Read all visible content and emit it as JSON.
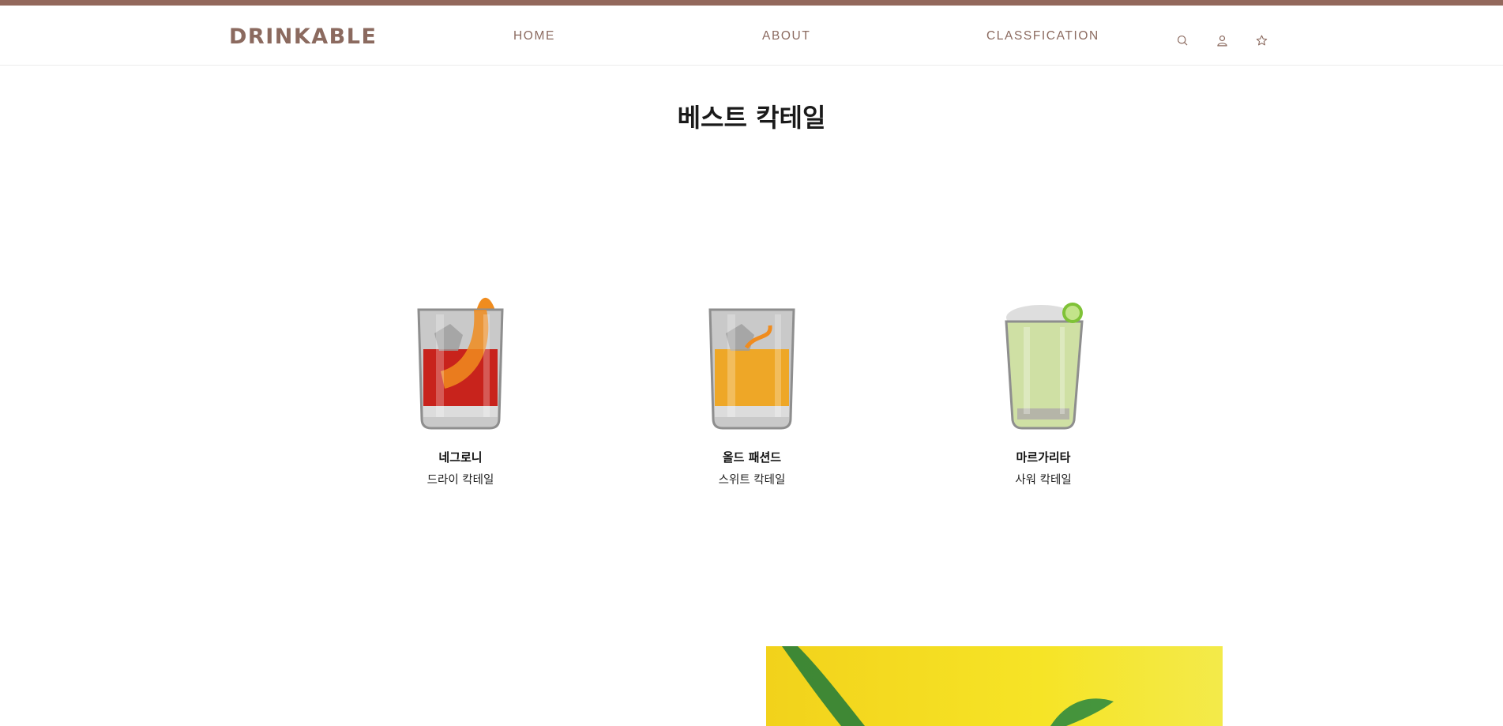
{
  "header": {
    "logo": "DRINKABLE",
    "nav": {
      "home": "HOME",
      "about": "ABOUT",
      "classification": "CLASSFICATION"
    },
    "icons": [
      "search-icon",
      "user-icon",
      "star-icon"
    ]
  },
  "best_section": {
    "title": "베스트 칵테일",
    "items": [
      {
        "name": "네그로니",
        "category": "드라이 칵테일",
        "liquid_color": "#c8231c"
      },
      {
        "name": "올드 패션드",
        "category": "스위트 칵테일",
        "liquid_color": "#eea727"
      },
      {
        "name": "마르가리타",
        "category": "사워 칵테일",
        "liquid_color": "#cfe0a4"
      }
    ]
  },
  "colors": {
    "brand": "#93685c",
    "nav_text": "#8b6a5f",
    "banner_yellow": "#f4dc1f"
  }
}
